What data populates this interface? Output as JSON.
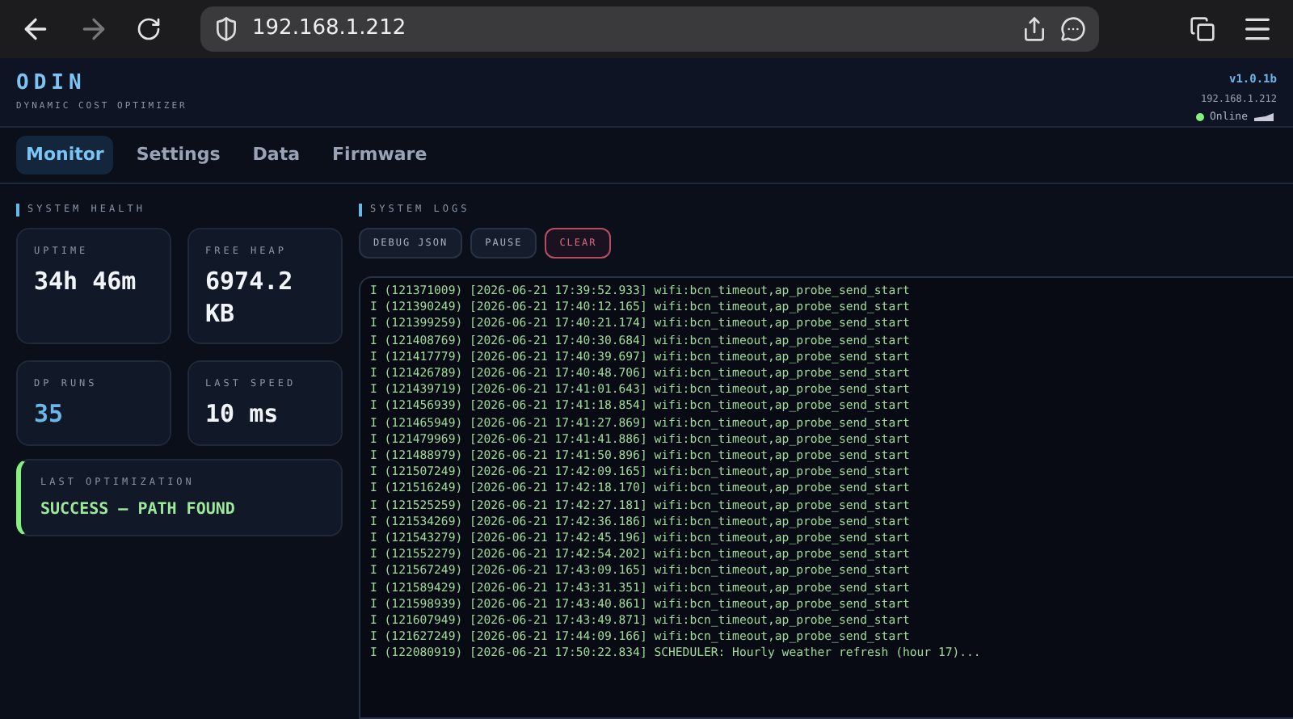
{
  "browser": {
    "url": "192.168.1.212",
    "forward_disabled": true
  },
  "header": {
    "title": "ODIN",
    "subtitle": "DYNAMIC COST OPTIMIZER",
    "version": "v1.0.1b",
    "ip": "192.168.1.212",
    "status": "Online",
    "online": true
  },
  "tabs": [
    {
      "label": "Monitor",
      "selected": true
    },
    {
      "label": "Settings",
      "selected": false
    },
    {
      "label": "Data",
      "selected": false
    },
    {
      "label": "Firmware",
      "selected": false
    }
  ],
  "health": {
    "title": "SYSTEM HEALTH",
    "stats": [
      {
        "label": "UPTIME",
        "value": "34h 46m",
        "highlight": false
      },
      {
        "label": "FREE HEAP",
        "value": "6974.2 KB",
        "highlight": false
      },
      {
        "label": "DP RUNS",
        "value": "35",
        "highlight": true
      },
      {
        "label": "LAST SPEED",
        "value": "10 ms",
        "highlight": false
      }
    ],
    "last_optimization": {
      "label": "LAST OPTIMIZATION",
      "value": "SUCCESS — PATH FOUND"
    }
  },
  "logs": {
    "title": "SYSTEM LOGS",
    "buttons": [
      {
        "label": "DEBUG JSON",
        "kind": "normal"
      },
      {
        "label": "PAUSE",
        "kind": "normal"
      },
      {
        "label": "CLEAR",
        "kind": "danger"
      }
    ],
    "lines": [
      "I (121371009) [2026-06-21 17:39:52.933] wifi:bcn_timeout,ap_probe_send_start",
      "I (121390249) [2026-06-21 17:40:12.165] wifi:bcn_timeout,ap_probe_send_start",
      "I (121399259) [2026-06-21 17:40:21.174] wifi:bcn_timeout,ap_probe_send_start",
      "I (121408769) [2026-06-21 17:40:30.684] wifi:bcn_timeout,ap_probe_send_start",
      "I (121417779) [2026-06-21 17:40:39.697] wifi:bcn_timeout,ap_probe_send_start",
      "I (121426789) [2026-06-21 17:40:48.706] wifi:bcn_timeout,ap_probe_send_start",
      "I (121439719) [2026-06-21 17:41:01.643] wifi:bcn_timeout,ap_probe_send_start",
      "I (121456939) [2026-06-21 17:41:18.854] wifi:bcn_timeout,ap_probe_send_start",
      "I (121465949) [2026-06-21 17:41:27.869] wifi:bcn_timeout,ap_probe_send_start",
      "I (121479969) [2026-06-21 17:41:41.886] wifi:bcn_timeout,ap_probe_send_start",
      "I (121488979) [2026-06-21 17:41:50.896] wifi:bcn_timeout,ap_probe_send_start",
      "I (121507249) [2026-06-21 17:42:09.165] wifi:bcn_timeout,ap_probe_send_start",
      "I (121516249) [2026-06-21 17:42:18.170] wifi:bcn_timeout,ap_probe_send_start",
      "I (121525259) [2026-06-21 17:42:27.181] wifi:bcn_timeout,ap_probe_send_start",
      "I (121534269) [2026-06-21 17:42:36.186] wifi:bcn_timeout,ap_probe_send_start",
      "I (121543279) [2026-06-21 17:42:45.196] wifi:bcn_timeout,ap_probe_send_start",
      "I (121552279) [2026-06-21 17:42:54.202] wifi:bcn_timeout,ap_probe_send_start",
      "I (121567249) [2026-06-21 17:43:09.165] wifi:bcn_timeout,ap_probe_send_start",
      "I (121589429) [2026-06-21 17:43:31.351] wifi:bcn_timeout,ap_probe_send_start",
      "I (121598939) [2026-06-21 17:43:40.861] wifi:bcn_timeout,ap_probe_send_start",
      "I (121607949) [2026-06-21 17:43:49.871] wifi:bcn_timeout,ap_probe_send_start",
      "I (121627249) [2026-06-21 17:44:09.166] wifi:bcn_timeout,ap_probe_send_start",
      "I (122080919) [2026-06-21 17:50:22.834] SCHEDULER: Hourly weather refresh (hour 17)..."
    ]
  }
}
